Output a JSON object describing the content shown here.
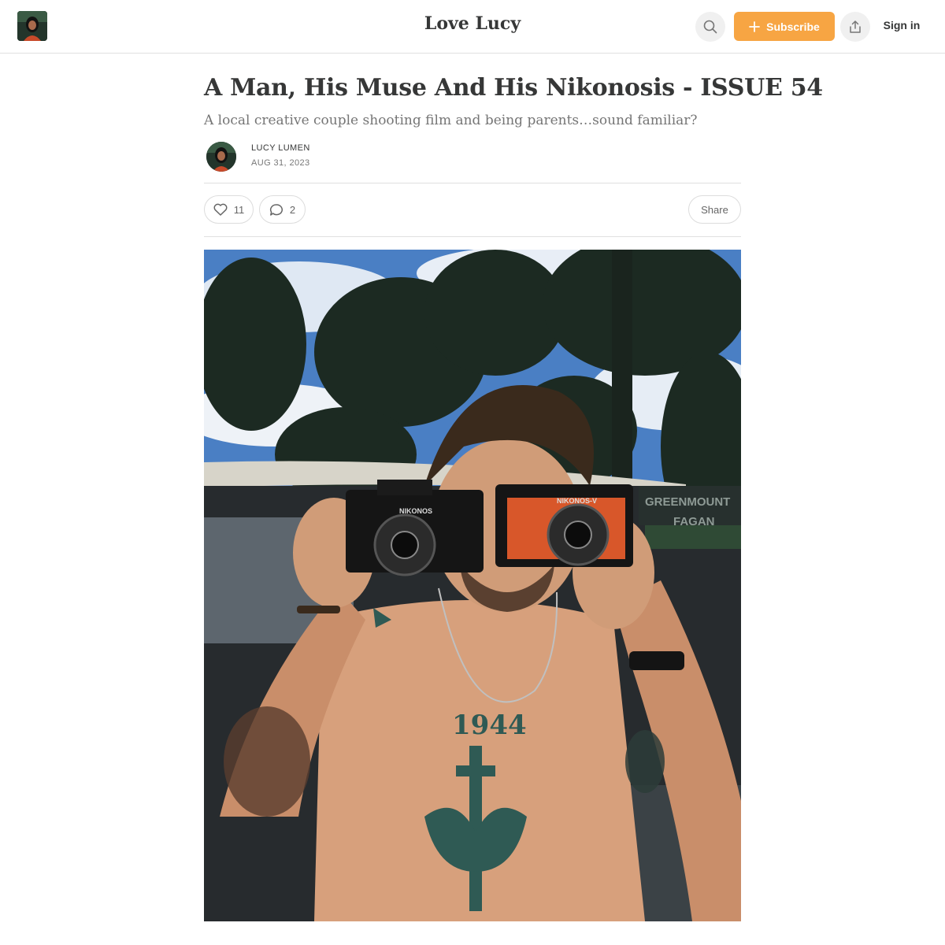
{
  "header": {
    "publication_title": "Love Lucy",
    "subscribe_label": "Subscribe",
    "signin_label": "Sign in",
    "icons": {
      "logo": "publication-avatar",
      "search": "search-icon",
      "subscribe": "plus-icon",
      "share": "share-icon"
    },
    "colors": {
      "accent": "#f7a543",
      "icon_button_bg": "#f0f0f0"
    }
  },
  "post": {
    "title": "A Man, His Muse And His Nikonosis - ISSUE 54",
    "subtitle": "A local creative couple shooting film and being parents…sound familiar?",
    "author": "LUCY LUMEN",
    "date": "AUG 31, 2023",
    "likes": "11",
    "comments": "2",
    "share_label": "Share"
  },
  "hero_image": {
    "texts": {
      "camera_left": "NIKONOS",
      "camera_right": "NIKONOS-V",
      "tattoo_chest": "1944",
      "sign_line1": "GREENMOUNT",
      "sign_line2": "FAGAN"
    }
  }
}
